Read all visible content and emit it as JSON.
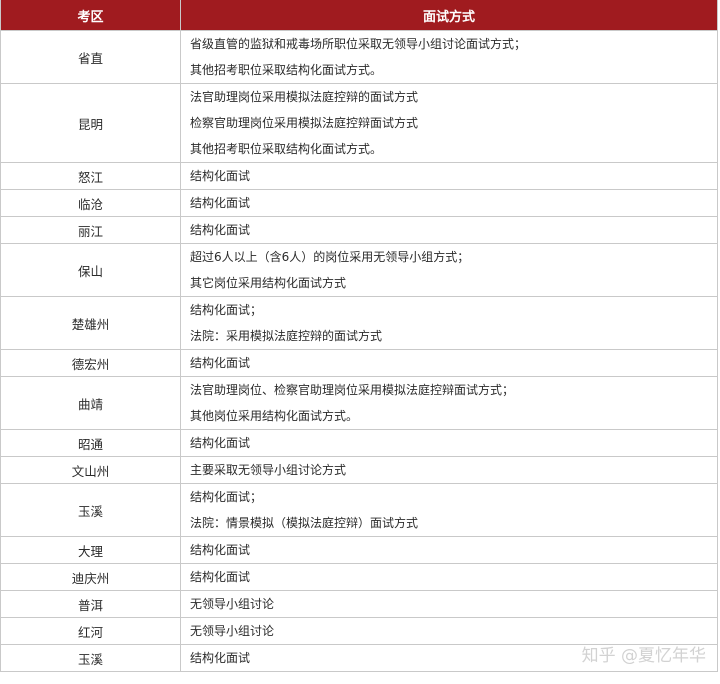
{
  "header": {
    "col_region": "考区",
    "col_method": "面试方式"
  },
  "rows": [
    {
      "region": "省直",
      "lines": [
        "省级直管的监狱和戒毒场所职位采取无领导小组讨论面试方式；",
        "其他招考职位采取结构化面试方式。"
      ]
    },
    {
      "region": "昆明",
      "lines": [
        "法官助理岗位采用模拟法庭控辩的面试方式",
        "检察官助理岗位采用模拟法庭控辩面试方式",
        "其他招考职位采取结构化面试方式。"
      ]
    },
    {
      "region": "怒江",
      "lines": [
        "结构化面试"
      ]
    },
    {
      "region": "临沧",
      "lines": [
        "结构化面试"
      ]
    },
    {
      "region": "丽江",
      "lines": [
        "结构化面试"
      ]
    },
    {
      "region": "保山",
      "lines": [
        "超过6人以上（含6人）的岗位采用无领导小组方式；",
        "其它岗位采用结构化面试方式"
      ]
    },
    {
      "region": "楚雄州",
      "lines": [
        "结构化面试；",
        "法院：采用模拟法庭控辩的面试方式"
      ]
    },
    {
      "region": "德宏州",
      "lines": [
        "结构化面试"
      ]
    },
    {
      "region": "曲靖",
      "lines": [
        "法官助理岗位、检察官助理岗位采用模拟法庭控辩面试方式；",
        "其他岗位采用结构化面试方式。"
      ]
    },
    {
      "region": "昭通",
      "lines": [
        "结构化面试"
      ]
    },
    {
      "region": "文山州",
      "lines": [
        "主要采取无领导小组讨论方式"
      ]
    },
    {
      "region": "玉溪",
      "lines": [
        "结构化面试；",
        "法院：情景模拟（模拟法庭控辩）面试方式"
      ]
    },
    {
      "region": "大理",
      "lines": [
        "结构化面试"
      ]
    },
    {
      "region": "迪庆州",
      "lines": [
        "结构化面试"
      ]
    },
    {
      "region": "普洱",
      "lines": [
        "无领导小组讨论"
      ]
    },
    {
      "region": "红河",
      "lines": [
        "无领导小组讨论"
      ]
    },
    {
      "region": "玉溪",
      "lines": [
        "结构化面试"
      ]
    }
  ],
  "watermark": "知乎 @夏忆年华"
}
